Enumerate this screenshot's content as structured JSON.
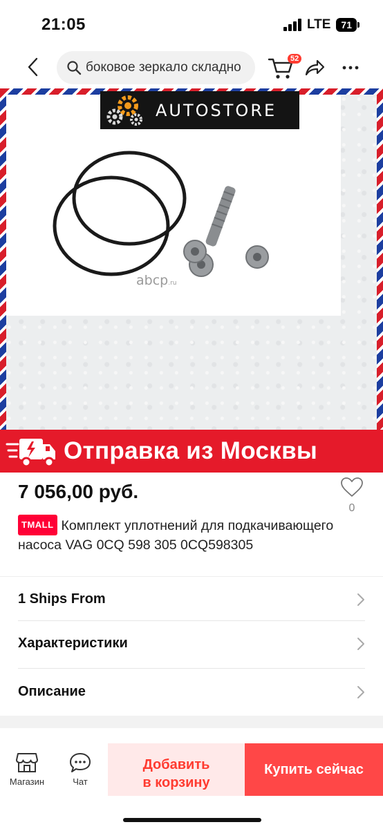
{
  "status": {
    "time": "21:05",
    "network": "LTE",
    "battery": "71"
  },
  "header": {
    "search_query": "боковое зеркало складно",
    "cart_count": "52"
  },
  "product_image": {
    "store_logo": "AUTOSTORE",
    "watermark": "abcp",
    "watermark_suffix": ".ru",
    "banner_text": "Отправка из Москвы"
  },
  "product": {
    "price": "7 056,00 руб.",
    "favorites_count": "0",
    "badge": "TMALL",
    "title": "Комплект уплотнений для подкачивающего насоса VAG 0CQ 598 305 0CQ598305"
  },
  "rows": [
    {
      "label": "1 Ships From"
    },
    {
      "label": "Характеристики"
    },
    {
      "label": "Описание"
    }
  ],
  "bottom_bar": {
    "store_label": "Магазин",
    "chat_label": "Чат",
    "add_to_cart_line1": "Добавить",
    "add_to_cart_line2": "в корзину",
    "buy_now": "Купить сейчас"
  },
  "colors": {
    "accent": "#ff4747",
    "tmall": "#ff0036",
    "banner": "#e51a2a"
  }
}
